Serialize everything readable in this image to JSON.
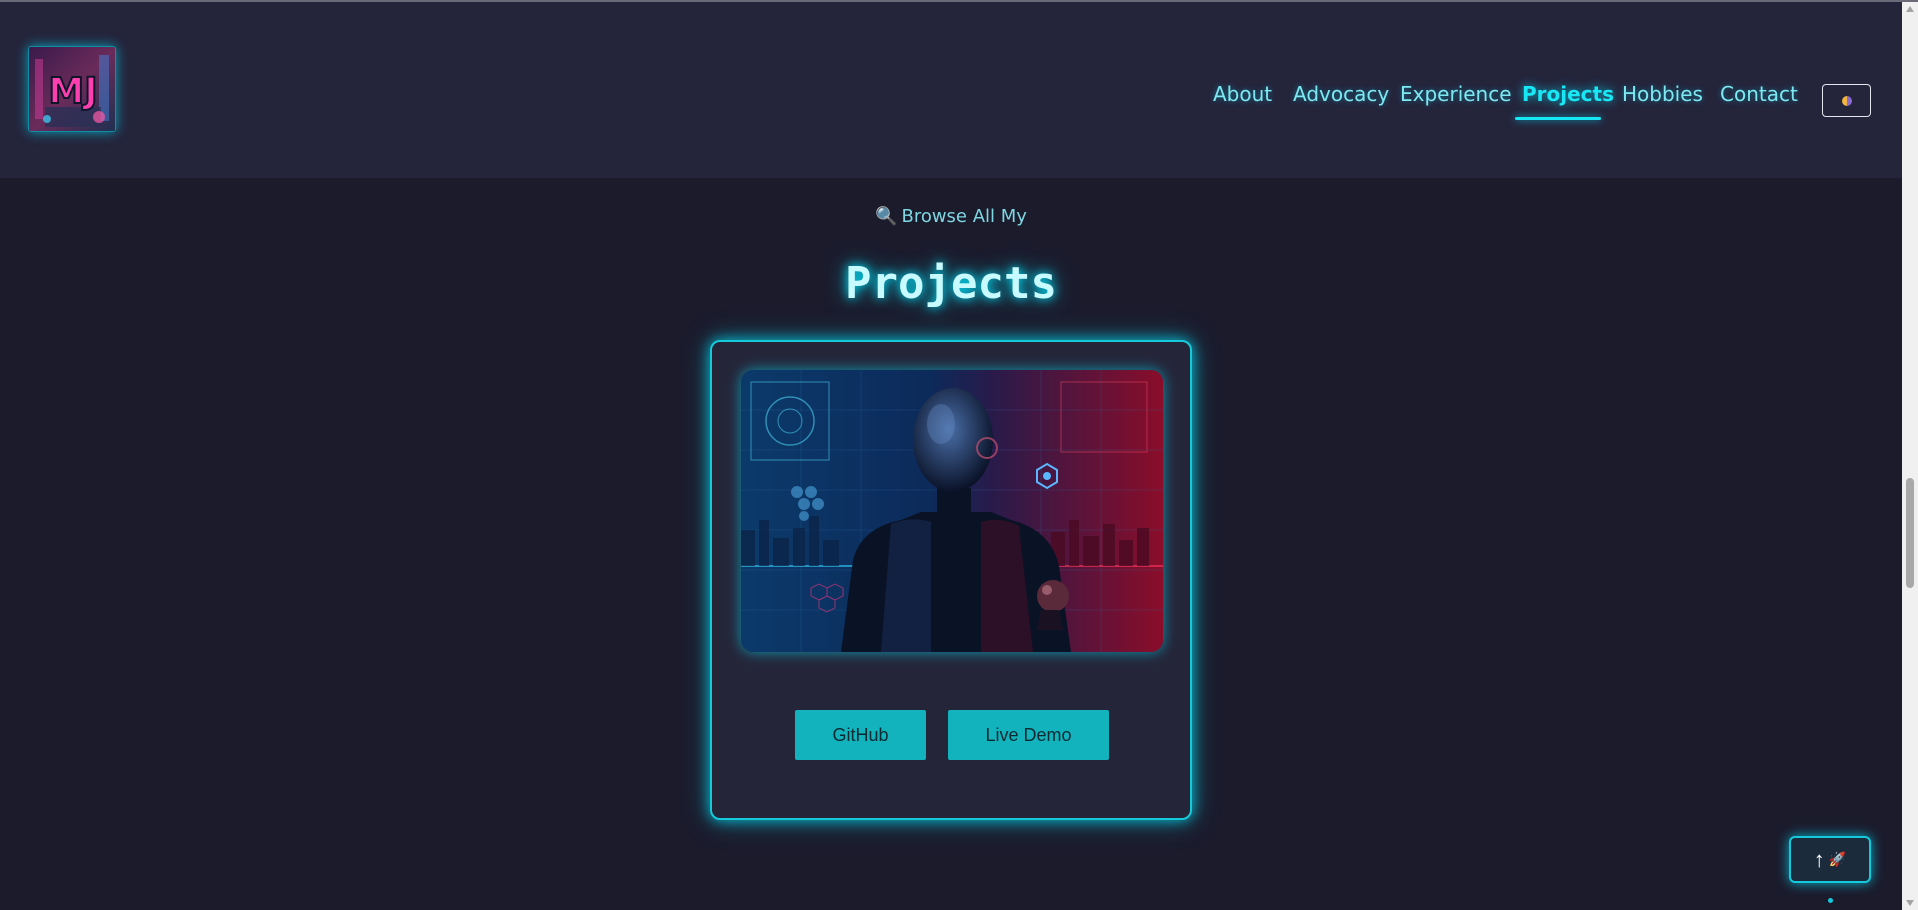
{
  "header": {
    "logo_text": "MJ",
    "nav": [
      "About",
      "Advocacy",
      "Experience",
      "Projects",
      "Hobbies",
      "Contact"
    ],
    "active_nav": "Projects",
    "theme_toggle_icon": "half-moon-icon"
  },
  "section": {
    "eyebrow_icon": "🔍",
    "eyebrow": "Browse All My",
    "title": "Projects"
  },
  "project_card": {
    "image_icon": "cyborg-illustration",
    "buttons": {
      "github": "GitHub",
      "live_demo": "Live Demo"
    }
  },
  "scroll_top": {
    "arrow": "↑",
    "icon": "🚀"
  },
  "colors": {
    "background": "#1b1b2c",
    "header": "#24243b",
    "accent": "#18e8f5",
    "button": "#12b3bd"
  }
}
